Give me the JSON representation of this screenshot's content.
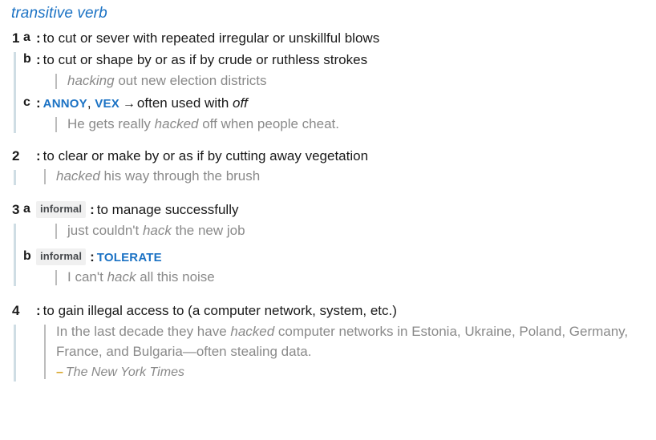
{
  "entry": {
    "part_of_speech": "transitive verb",
    "colon": ":",
    "arrow_icon": "→",
    "attribution_dash": "–",
    "colors": {
      "link_blue": "#1b72c4",
      "group_rule": "#cfdde4",
      "example_rule": "#bcbcbc",
      "example_text": "#8a8a8a",
      "definition_text": "#1a1a1a",
      "badge_background": "#f0f0f0",
      "badge_text": "#46494c",
      "attribution_dash": "#d8a72b"
    },
    "senses": [
      {
        "number": "1",
        "subsenses": [
          {
            "letter": "a",
            "definition": "to cut or sever with repeated irregular or unskillful blows",
            "examples": []
          },
          {
            "letter": "b",
            "definition": "to cut or shape by or as if by crude or ruthless strokes",
            "examples": [
              {
                "italic_lead": "hacking",
                "rest": " out new election districts"
              }
            ]
          },
          {
            "letter": "c",
            "xrefs": [
              "ANNOY",
              "VEX"
            ],
            "xref_separator": ", ",
            "usage_note_prefix": "often used with ",
            "usage_note_italic": "off",
            "examples": [
              {
                "pre": "He gets really ",
                "italic": "hacked",
                "post": " off when people cheat."
              }
            ]
          }
        ]
      },
      {
        "number": "2",
        "subsenses": [
          {
            "letter": "",
            "definition": "to clear or make by or as if by cutting away vegetation",
            "examples": [
              {
                "italic_lead": "hacked",
                "rest": " his way through the brush"
              }
            ]
          }
        ]
      },
      {
        "number": "3",
        "subsenses": [
          {
            "letter": "a",
            "label": "informal",
            "definition": "to manage successfully",
            "examples": [
              {
                "pre": "just couldn't ",
                "italic": "hack",
                "post": " the new job"
              }
            ]
          },
          {
            "letter": "b",
            "label": "informal",
            "xrefs": [
              "TOLERATE"
            ],
            "examples": [
              {
                "pre": "I can't ",
                "italic": "hack",
                "post": " all this noise"
              }
            ]
          }
        ]
      },
      {
        "number": "4",
        "subsenses": [
          {
            "letter": "",
            "definition": "to gain illegal access to (a computer network, system, etc.)",
            "examples": [
              {
                "pre": "In the last decade they have ",
                "italic": "hacked",
                "post": " computer networks in Estonia, Ukraine, Poland, Germany, France, and Bulgaria—often stealing data."
              }
            ],
            "attribution": "The New York Times"
          }
        ]
      }
    ]
  }
}
